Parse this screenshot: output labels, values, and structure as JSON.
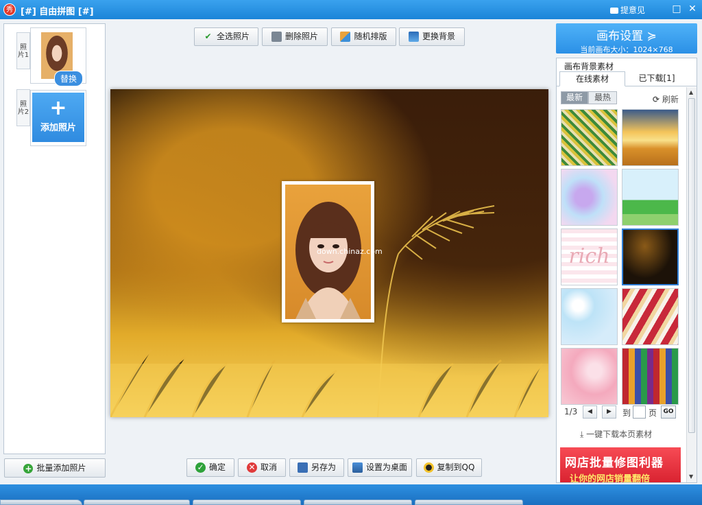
{
  "window": {
    "app_icon": "秀",
    "title": "[#] 自由拼图 [#]",
    "feedback": "提意见",
    "maximize_icon": "□",
    "close_icon": "✕"
  },
  "left_panel": {
    "slots": [
      {
        "tab": "照片1",
        "action": "替换"
      },
      {
        "tab": "照片2",
        "action": "添加照片",
        "plus": "+"
      }
    ],
    "batch_add": "批量添加照片"
  },
  "toolbar": {
    "select_all": "全选照片",
    "delete": "删除照片",
    "random_layout": "随机排版",
    "change_bg": "更换背景"
  },
  "canvas": {
    "watermark": "down.chinaz.com"
  },
  "bottom_bar": {
    "ok": "确定",
    "cancel": "取消",
    "save_as": "另存为",
    "set_desktop": "设置为桌面",
    "copy_qq": "复制到QQ"
  },
  "right_panel": {
    "settings_title": "画布设置",
    "settings_chevron": "≽",
    "canvas_size": "当前画布大小：1024×768",
    "bg_section": "画布背景素材",
    "tab_online": "在线素材",
    "tab_downloaded": "已下载[1]",
    "seg_new": "最新",
    "seg_hot": "最热",
    "refresh": "刷新",
    "thumb_text": "rich",
    "page_current": "1/3",
    "page_to": "到",
    "page_unit": "页",
    "go": "GO",
    "download_all": "一键下载本页素材",
    "banner_line1": "网店批量修图利器",
    "banner_line2": "让你的网店销量翻倍"
  },
  "colors": {
    "title_bar": "#1b84d8",
    "accent": "#2f8be0",
    "banner": "#e12b38"
  }
}
